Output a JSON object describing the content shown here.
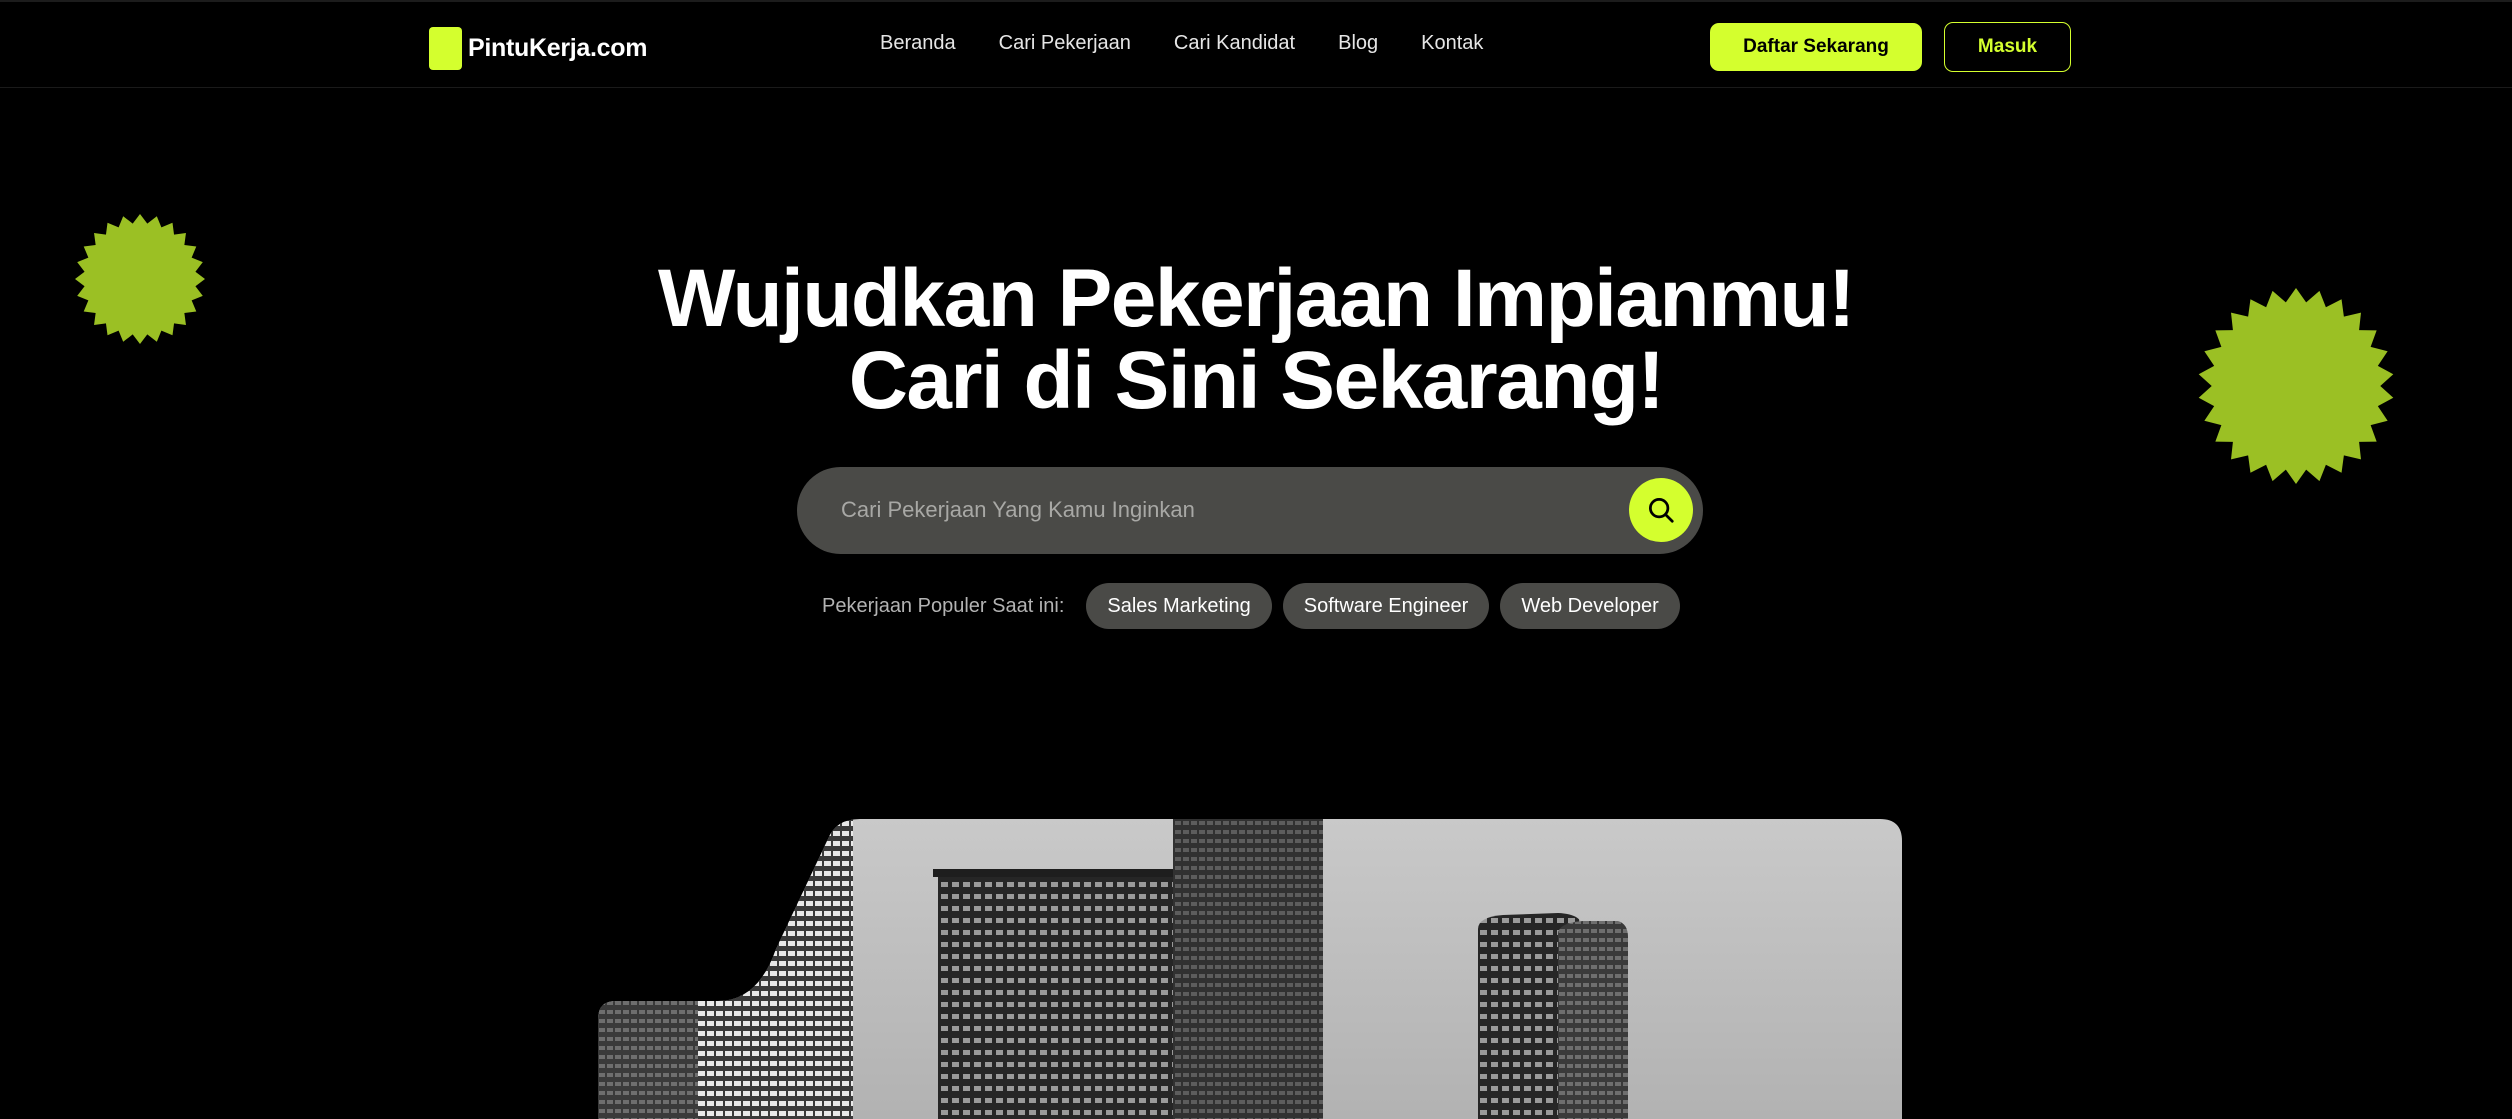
{
  "header": {
    "brand": "PintuKerja.com",
    "nav": [
      {
        "label": "Beranda"
      },
      {
        "label": "Cari Pekerjaan"
      },
      {
        "label": "Cari Kandidat"
      },
      {
        "label": "Blog"
      },
      {
        "label": "Kontak"
      }
    ],
    "register_label": "Daftar Sekarang",
    "login_label": "Masuk"
  },
  "hero": {
    "title_line1": "Wujudkan Pekerjaan Impianmu!",
    "title_line2": "Cari di Sini Sekarang!",
    "search": {
      "placeholder": "Cari Pekerjaan Yang Kamu Inginkan",
      "value": "",
      "icon": "search-icon"
    },
    "popular_label": "Pekerjaan Populer Saat ini:",
    "popular_tags": [
      {
        "label": "Sales Marketing"
      },
      {
        "label": "Software Engineer"
      },
      {
        "label": "Web Developer"
      }
    ]
  },
  "decor": {
    "badge_icon": "starburst-badge-icon",
    "image": "city-skyscrapers-photo"
  },
  "colors": {
    "accent": "#d4ff2e",
    "badge": "#9bc024",
    "background": "#000000",
    "input_background": "#4a4a47"
  }
}
